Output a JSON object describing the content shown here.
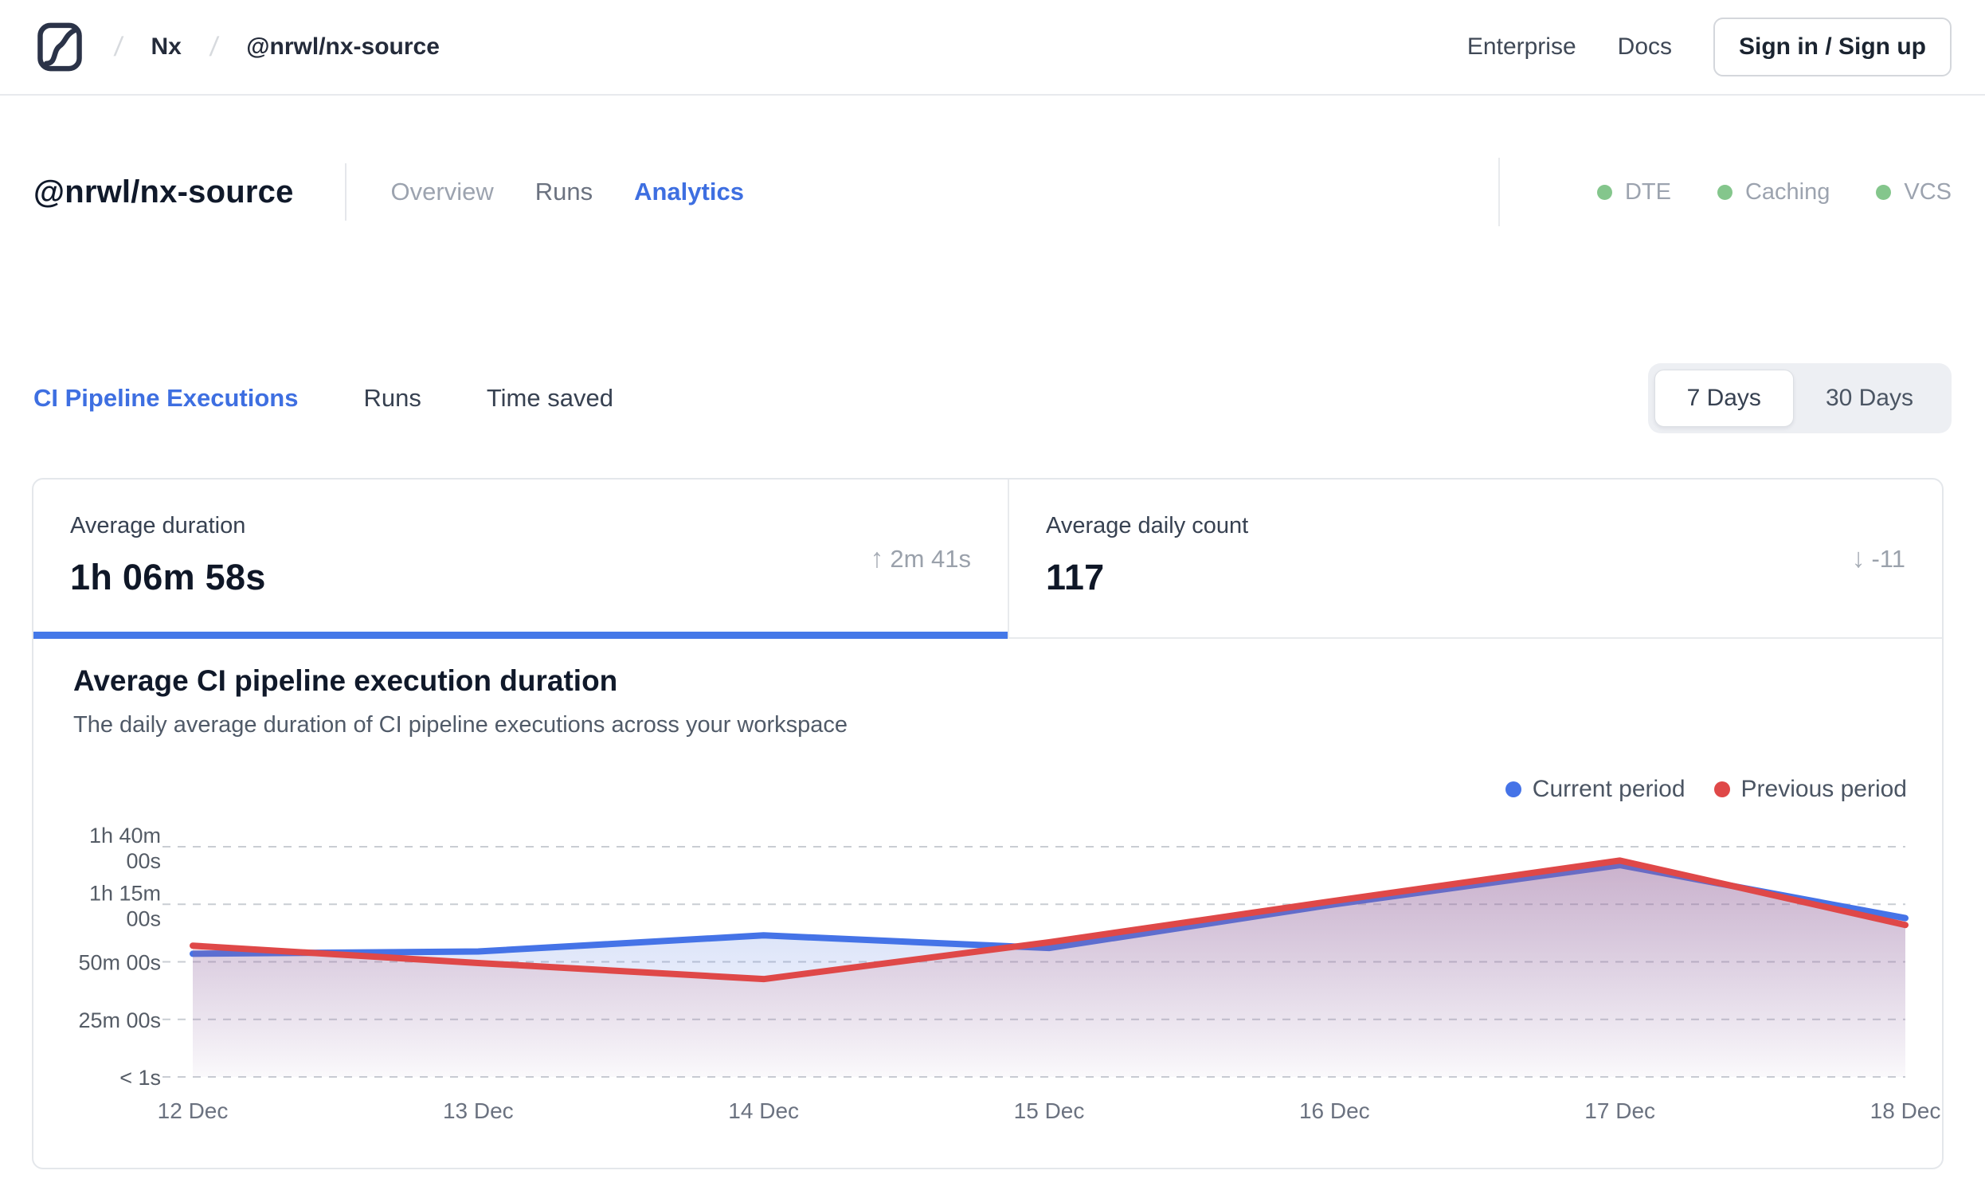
{
  "navbar": {
    "breadcrumb": {
      "separator": "/",
      "items": [
        "Nx",
        "@nrwl/nx-source"
      ]
    },
    "links": [
      "Enterprise",
      "Docs"
    ],
    "signin_label": "Sign in / Sign up"
  },
  "workspace": {
    "title": "@nrwl/nx-source",
    "tabs": [
      {
        "label": "Overview",
        "active": false
      },
      {
        "label": "Runs",
        "active": false
      },
      {
        "label": "Analytics",
        "active": true
      }
    ],
    "status_badges": [
      {
        "label": "DTE",
        "enabled": true
      },
      {
        "label": "Caching",
        "enabled": true
      },
      {
        "label": "VCS",
        "enabled": true
      }
    ],
    "status_dot_color": "#84c68c"
  },
  "analytics": {
    "tabs": [
      {
        "label": "CI Pipeline Executions",
        "active": true
      },
      {
        "label": "Runs",
        "active": false
      },
      {
        "label": "Time saved",
        "active": false
      }
    ],
    "range_toggle": [
      {
        "label": "7 Days",
        "active": true
      },
      {
        "label": "30 Days",
        "active": false
      }
    ],
    "stat_cards": [
      {
        "label": "Average duration",
        "value": "1h 06m 58s",
        "delta_icon": "↑",
        "delta": "2m 41s",
        "active": true
      },
      {
        "label": "Average daily count",
        "value": "117",
        "delta_icon": "↓",
        "delta": "-11",
        "active": false
      }
    ],
    "accent_color": "#4478e8"
  },
  "chart_card": {
    "title": "Average CI pipeline execution duration",
    "subtitle": "The daily average duration of CI pipeline executions across your workspace"
  },
  "chart_data": {
    "type": "area",
    "title": "Average CI pipeline execution duration",
    "x": [
      "12 Dec",
      "13 Dec",
      "14 Dec",
      "15 Dec",
      "16 Dec",
      "17 Dec",
      "18 Dec"
    ],
    "series": [
      {
        "name": "Current period",
        "color": "#4573e7",
        "fill_color": "#5b7ee0",
        "values_minutes": [
          53.5,
          54.5,
          61.5,
          56,
          75,
          92,
          69
        ]
      },
      {
        "name": "Previous period",
        "color": "#df4848",
        "fill_color": "#c2566b",
        "values_minutes": [
          57,
          49.5,
          42.5,
          58.5,
          76.5,
          94,
          66
        ]
      }
    ],
    "yticks": [
      {
        "lines": [
          "1h 40m",
          "00s"
        ],
        "value": 100
      },
      {
        "lines": [
          "1h 15m",
          "00s"
        ],
        "value": 75
      },
      {
        "lines": [
          "50m 00s"
        ],
        "value": 50
      },
      {
        "lines": [
          "25m 00s"
        ],
        "value": 25
      },
      {
        "lines": [
          "< 1s"
        ],
        "value": 0
      }
    ],
    "ylim": [
      0,
      100
    ],
    "grid": "horizontal-dashed",
    "legend_position": "top-right"
  }
}
